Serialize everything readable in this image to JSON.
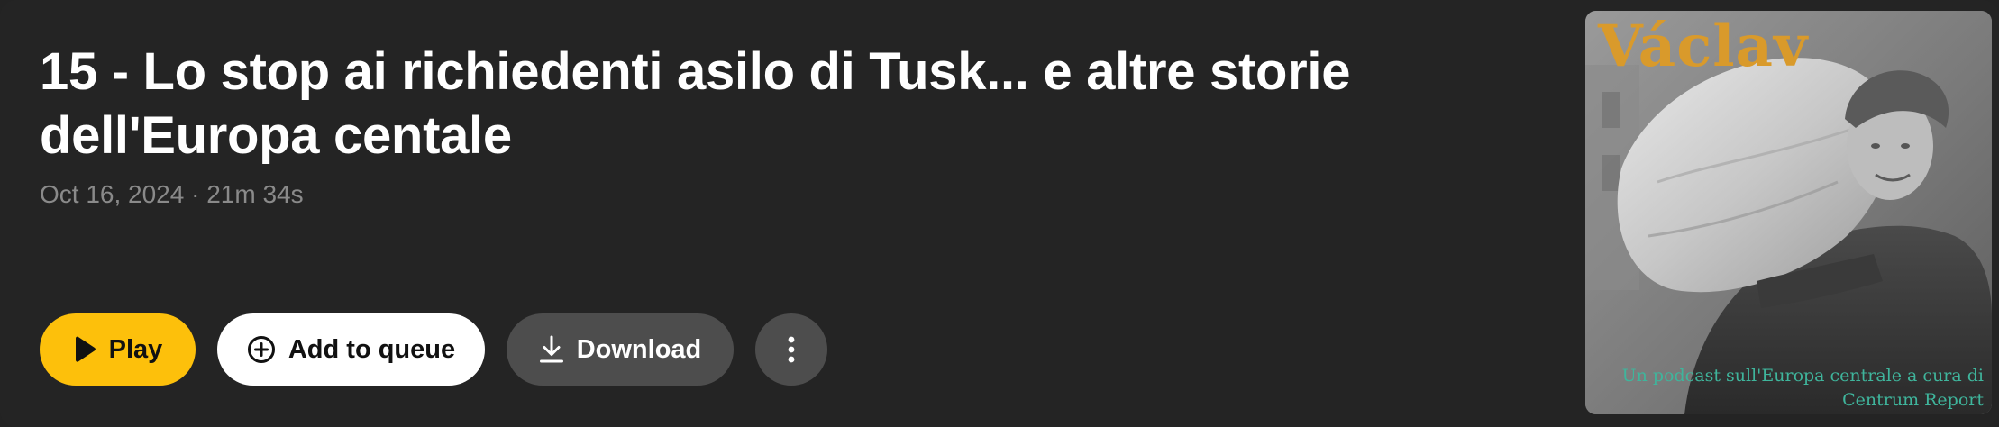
{
  "episode": {
    "title": "15 - Lo stop ai richiedenti asilo di Tusk... e altre storie dell'Europa centale",
    "date": "Oct 16, 2024",
    "separator": "·",
    "duration": "21m 34s"
  },
  "actions": {
    "play_label": "Play",
    "queue_label": "Add to queue",
    "download_label": "Download",
    "more_icon": "more-vertical-icon"
  },
  "cover": {
    "title": "Václav",
    "caption": "Un podcast sull'Europa centrale a cura di Centrum Report",
    "alt": "Václav podcast cover art"
  },
  "colors": {
    "background": "#242424",
    "play_accent": "#fdc00b",
    "secondary_button": "#4d4d4d",
    "cover_title": "#d99a2b",
    "cover_caption": "#3fb59c"
  }
}
